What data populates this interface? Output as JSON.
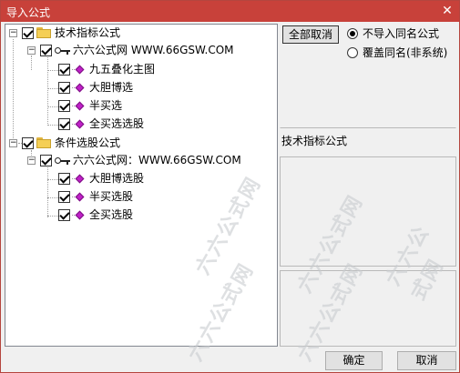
{
  "window": {
    "title": "导入公式",
    "close_glyph": "✕"
  },
  "tree": {
    "groups": [
      {
        "label": "技术指标公式",
        "expander": "−",
        "checked": true,
        "source": {
          "label": "六六公式网 WWW.66GSW.COM",
          "expander": "−",
          "checked": true
        },
        "items": [
          "九五叠化主图",
          "大胆博选",
          "半买选",
          "全买选选股"
        ]
      },
      {
        "label": "条件选股公式",
        "expander": "−",
        "checked": true,
        "source": {
          "label": "六六公式网：WWW.66GSW.COM",
          "expander": "−",
          "checked": true
        },
        "items": [
          "大胆博选股",
          "半买选股",
          "全买选股"
        ]
      }
    ]
  },
  "right": {
    "deselect_all": "全部取消",
    "radio_options": [
      {
        "label": "不导入同名公式",
        "selected": true
      },
      {
        "label": "覆盖同名(非系统)",
        "selected": false
      }
    ],
    "category_label": "技术指标公式"
  },
  "footer": {
    "ok": "确定",
    "cancel": "取消"
  },
  "watermark": "六六公式网"
}
